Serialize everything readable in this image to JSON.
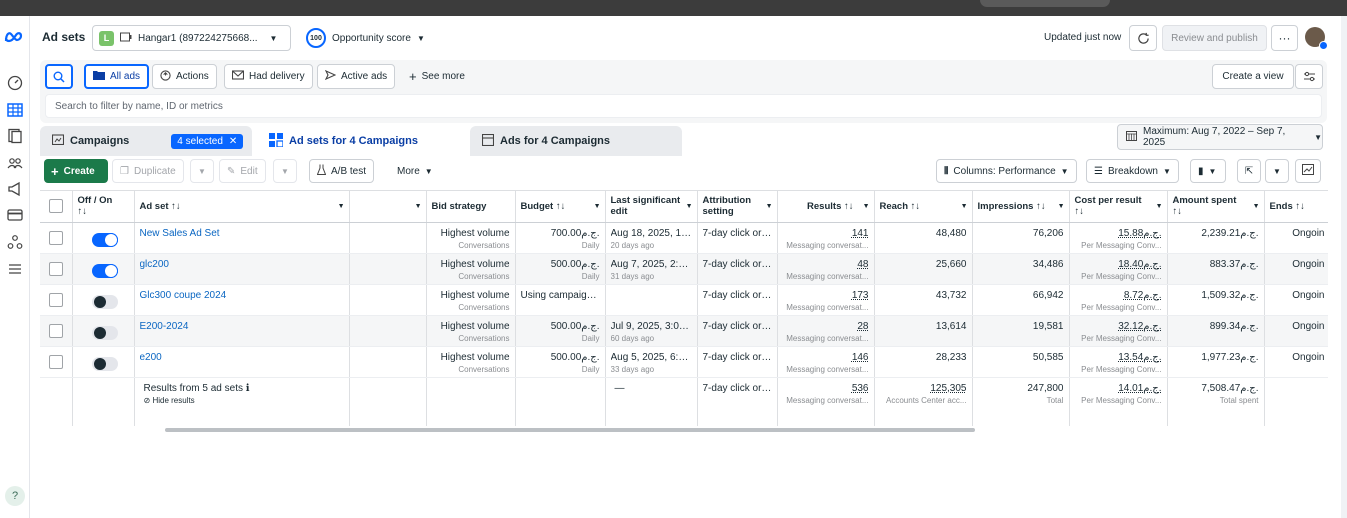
{
  "header": {
    "title": "Ad sets",
    "account_badge": "L",
    "account_name": "Hangar1 (897224275668...",
    "opportunity_value": "100",
    "opportunity_label": "Opportunity score",
    "updated": "Updated just now",
    "review_publish": "Review and publish",
    "more": "···"
  },
  "filters": {
    "all_ads": "All ads",
    "actions": "Actions",
    "had_delivery": "Had delivery",
    "active_ads": "Active ads",
    "see_more": "See more",
    "create_view": "Create a view",
    "search_placeholder": "Search to filter by name, ID or metrics"
  },
  "tabs": {
    "campaigns": "Campaigns",
    "selected": "4 selected",
    "adsets": "Ad sets for 4 Campaigns",
    "ads": "Ads for 4 Campaigns",
    "date_range": "Maximum: Aug 7, 2022 – Sep 7, 2025"
  },
  "toolbar": {
    "create": "Create",
    "duplicate": "Duplicate",
    "edit": "Edit",
    "ab_test": "A/B test",
    "more": "More",
    "columns": "Columns: Performance",
    "breakdown": "Breakdown"
  },
  "columns": {
    "offon": "Off / On",
    "offon_sort": "↑↓",
    "adset": "Ad set ↑↓",
    "bid": "Bid strategy",
    "budget": "Budget ↑↓",
    "edit1": "Last significant",
    "edit2": "edit",
    "attr1": "Attribution",
    "attr2": "setting",
    "results": "Results ↑↓",
    "reach": "Reach ↑↓",
    "impressions": "Impressions ↑↓",
    "cpr": "Cost per result",
    "cpr_sort": "↑↓",
    "spent": "Amount spent",
    "spent_sort": "↑↓",
    "ends": "Ends ↑↓"
  },
  "rows": [
    {
      "name": "New Sales Ad Set",
      "on": true,
      "bid": "Highest volume",
      "bid_sub": "Conversations",
      "budget": "700.00ج.م.",
      "budget_sub": "Daily",
      "edit": "Aug 18, 2025, 12...",
      "edit_sub": "20 days ago",
      "attr": "7-day click or ...",
      "results": "141",
      "results_sub": "Messaging conversat...",
      "reach": "48,480",
      "impressions": "76,206",
      "cpr": "15.88ج.م.",
      "cpr_sub": "Per Messaging Conv...",
      "spent": "2,239.21ج.م.",
      "ends": "Ongoin"
    },
    {
      "name": "glc200",
      "on": true,
      "bid": "Highest volume",
      "bid_sub": "Conversations",
      "budget": "500.00ج.م.",
      "budget_sub": "Daily",
      "edit": "Aug 7, 2025, 2:0...",
      "edit_sub": "31 days ago",
      "attr": "7-day click or ...",
      "results": "48",
      "results_sub": "Messaging conversat...",
      "reach": "25,660",
      "impressions": "34,486",
      "cpr": "18.40ج.م.",
      "cpr_sub": "Per Messaging Conv...",
      "spent": "883.37ج.م.",
      "ends": "Ongoin"
    },
    {
      "name": "Glc300 coupe 2024",
      "on": false,
      "bid": "Highest volume",
      "bid_sub": "Conversations",
      "budget": "Using campaign...",
      "budget_sub": "",
      "edit": "",
      "edit_sub": "",
      "attr": "7-day click or ...",
      "results": "173",
      "results_sub": "Messaging conversat...",
      "reach": "43,732",
      "impressions": "66,942",
      "cpr": "8.72ج.م.",
      "cpr_sub": "Per Messaging Conv...",
      "spent": "1,509.32ج.م.",
      "ends": "Ongoin"
    },
    {
      "name": "E200-2024",
      "on": false,
      "bid": "Highest volume",
      "bid_sub": "Conversations",
      "budget": "500.00ج.م.",
      "budget_sub": "Daily",
      "edit": "Jul 9, 2025, 3:07...",
      "edit_sub": "60 days ago",
      "attr": "7-day click or ...",
      "results": "28",
      "results_sub": "Messaging conversat...",
      "reach": "13,614",
      "impressions": "19,581",
      "cpr": "32.12ج.م.",
      "cpr_sub": "Per Messaging Conv...",
      "spent": "899.34ج.م.",
      "ends": "Ongoin"
    },
    {
      "name": "e200",
      "on": false,
      "bid": "Highest volume",
      "bid_sub": "Conversations",
      "budget": "500.00ج.م.",
      "budget_sub": "Daily",
      "edit": "Aug 5, 2025, 6:3...",
      "edit_sub": "33 days ago",
      "attr": "7-day click or ...",
      "results": "146",
      "results_sub": "Messaging conversat...",
      "reach": "28,233",
      "impressions": "50,585",
      "cpr": "13.54ج.م.",
      "cpr_sub": "Per Messaging Conv...",
      "spent": "1,977.23ج.م.",
      "ends": "Ongoin"
    }
  ],
  "summary": {
    "label": "Results from 5 ad sets",
    "info": "ℹ",
    "hide": "Hide results",
    "edit": "—",
    "attr": "7-day click or ...",
    "results": "536",
    "results_sub": "Messaging conversat...",
    "reach": "125,305",
    "reach_sub": "Accounts Center acc...",
    "impressions": "247,800",
    "impressions_sub": "Total",
    "cpr": "14.01ج.م.",
    "cpr_sub": "Per Messaging Conv...",
    "spent": "7,508.47ج.م.",
    "spent_sub": "Total spent"
  },
  "rail": {
    "help": "?"
  }
}
